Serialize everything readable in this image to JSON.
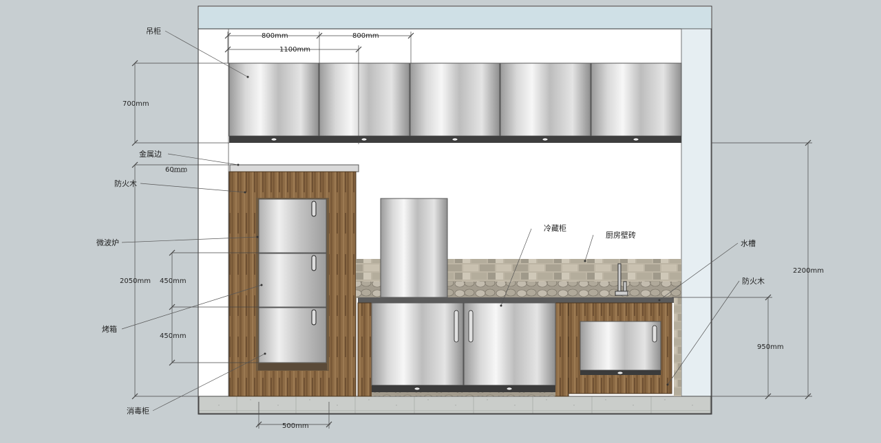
{
  "labels": {
    "wall_cabinet": "吊柜",
    "metal_edge": "金属边",
    "fireproof_wood_left": "防火木",
    "microwave": "微波炉",
    "oven": "烤箱",
    "disinfection_cabinet": "消毒柜",
    "refrigerator": "冷藏柜",
    "kitchen_tile": "厨房壁砖",
    "sink": "水槽",
    "fireproof_wood_right": "防火木"
  },
  "dimensions": {
    "wall_cabinet_width_a": "800mm",
    "wall_cabinet_width_b": "800mm",
    "wall_cabinet_overall": "1100mm",
    "wall_cabinet_height": "700mm",
    "metal_edge_thickness": "60mm",
    "tall_cabinet_height": "2050mm",
    "oven_height": "450mm",
    "disinfection_height": "450mm",
    "total_height": "2200mm",
    "counter_height": "950mm",
    "tall_cabinet_width": "500mm"
  },
  "colors": {
    "background": "#c7ced1",
    "wall": "#ffffff",
    "ceiling": "#cfe0e6",
    "wood": "#8a6a45",
    "steel_light": "#f2f2f2",
    "steel_dark": "#8c8c8c",
    "tile": "#b8b0a0",
    "floor": "#c8cbc8",
    "dim_line": "#444444"
  }
}
